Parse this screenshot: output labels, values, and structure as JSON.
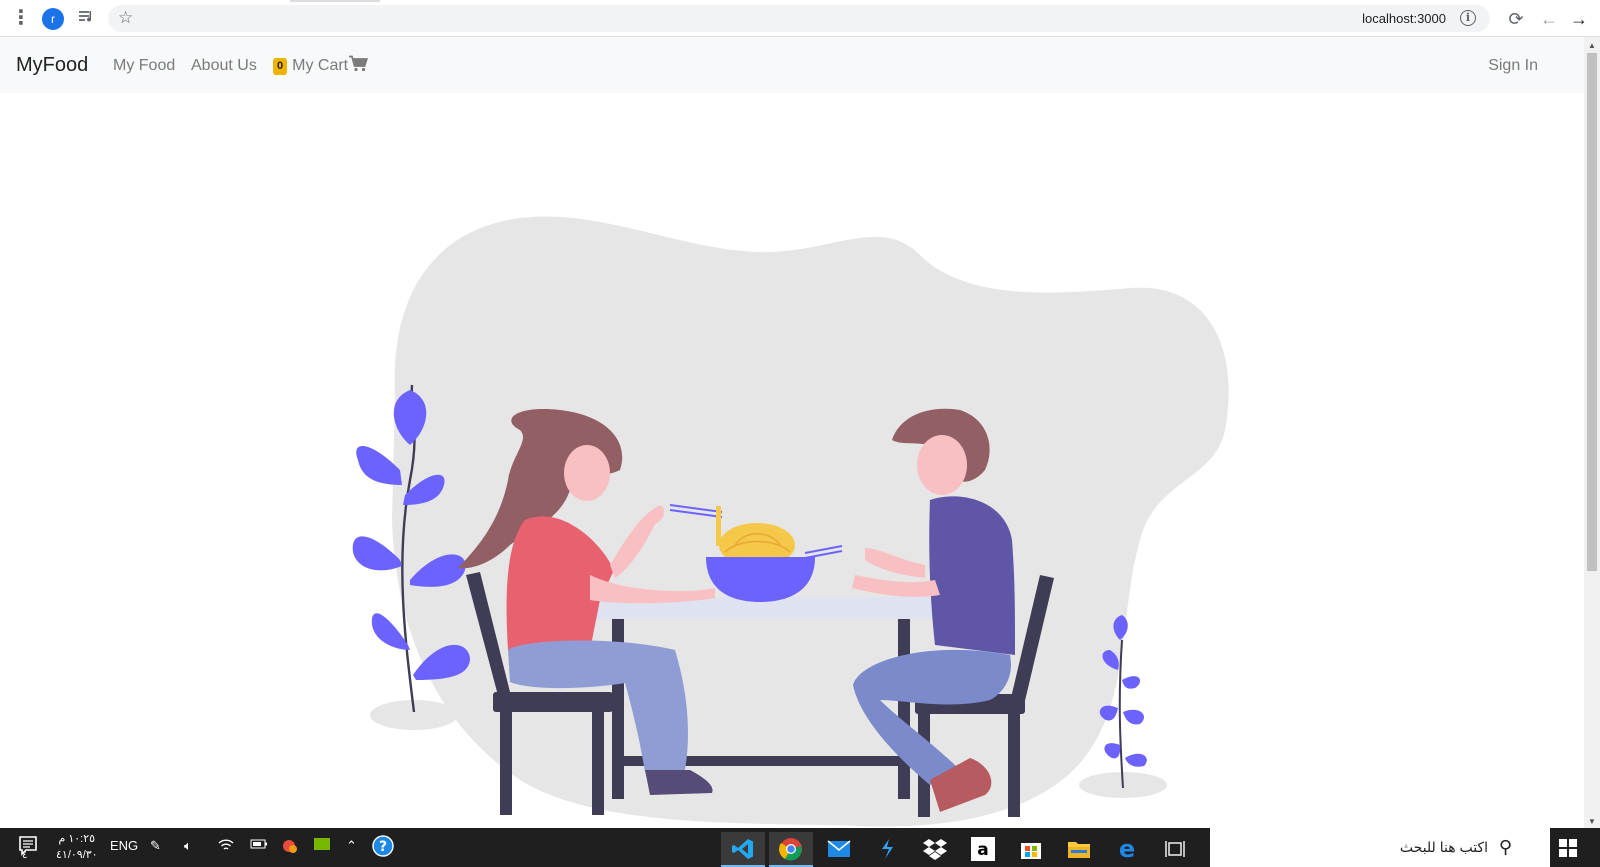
{
  "browser": {
    "url": "localhost:3000",
    "profile_initial": "r",
    "icons": [
      "kebab-menu-icon",
      "profile-avatar",
      "media-control-icon",
      "bookmark-star-icon",
      "site-info-icon",
      "reload-icon",
      "back-arrow-icon",
      "forward-arrow-icon"
    ]
  },
  "navbar": {
    "brand": "MyFood",
    "links": [
      "My Food",
      "About Us"
    ],
    "cart": {
      "count": "0",
      "label": "My Cart"
    },
    "signin": "Sign In"
  },
  "taskbar": {
    "search_placeholder": "اكتب هنا للبحث",
    "time": "١٠:٢٥ م",
    "date": "٤١/٠٩/٣٠",
    "language": "ENG",
    "notification_count": "٤",
    "apps": [
      "visual-studio-code",
      "google-chrome",
      "mail",
      "visual-studio",
      "dropbox",
      "amazon",
      "microsoft-store",
      "file-explorer",
      "edge",
      "task-view"
    ]
  },
  "colors": {
    "accent_purple": "#6c63ff",
    "badge_yellow": "#f0b400",
    "blob_gray": "#e6e6e6"
  }
}
